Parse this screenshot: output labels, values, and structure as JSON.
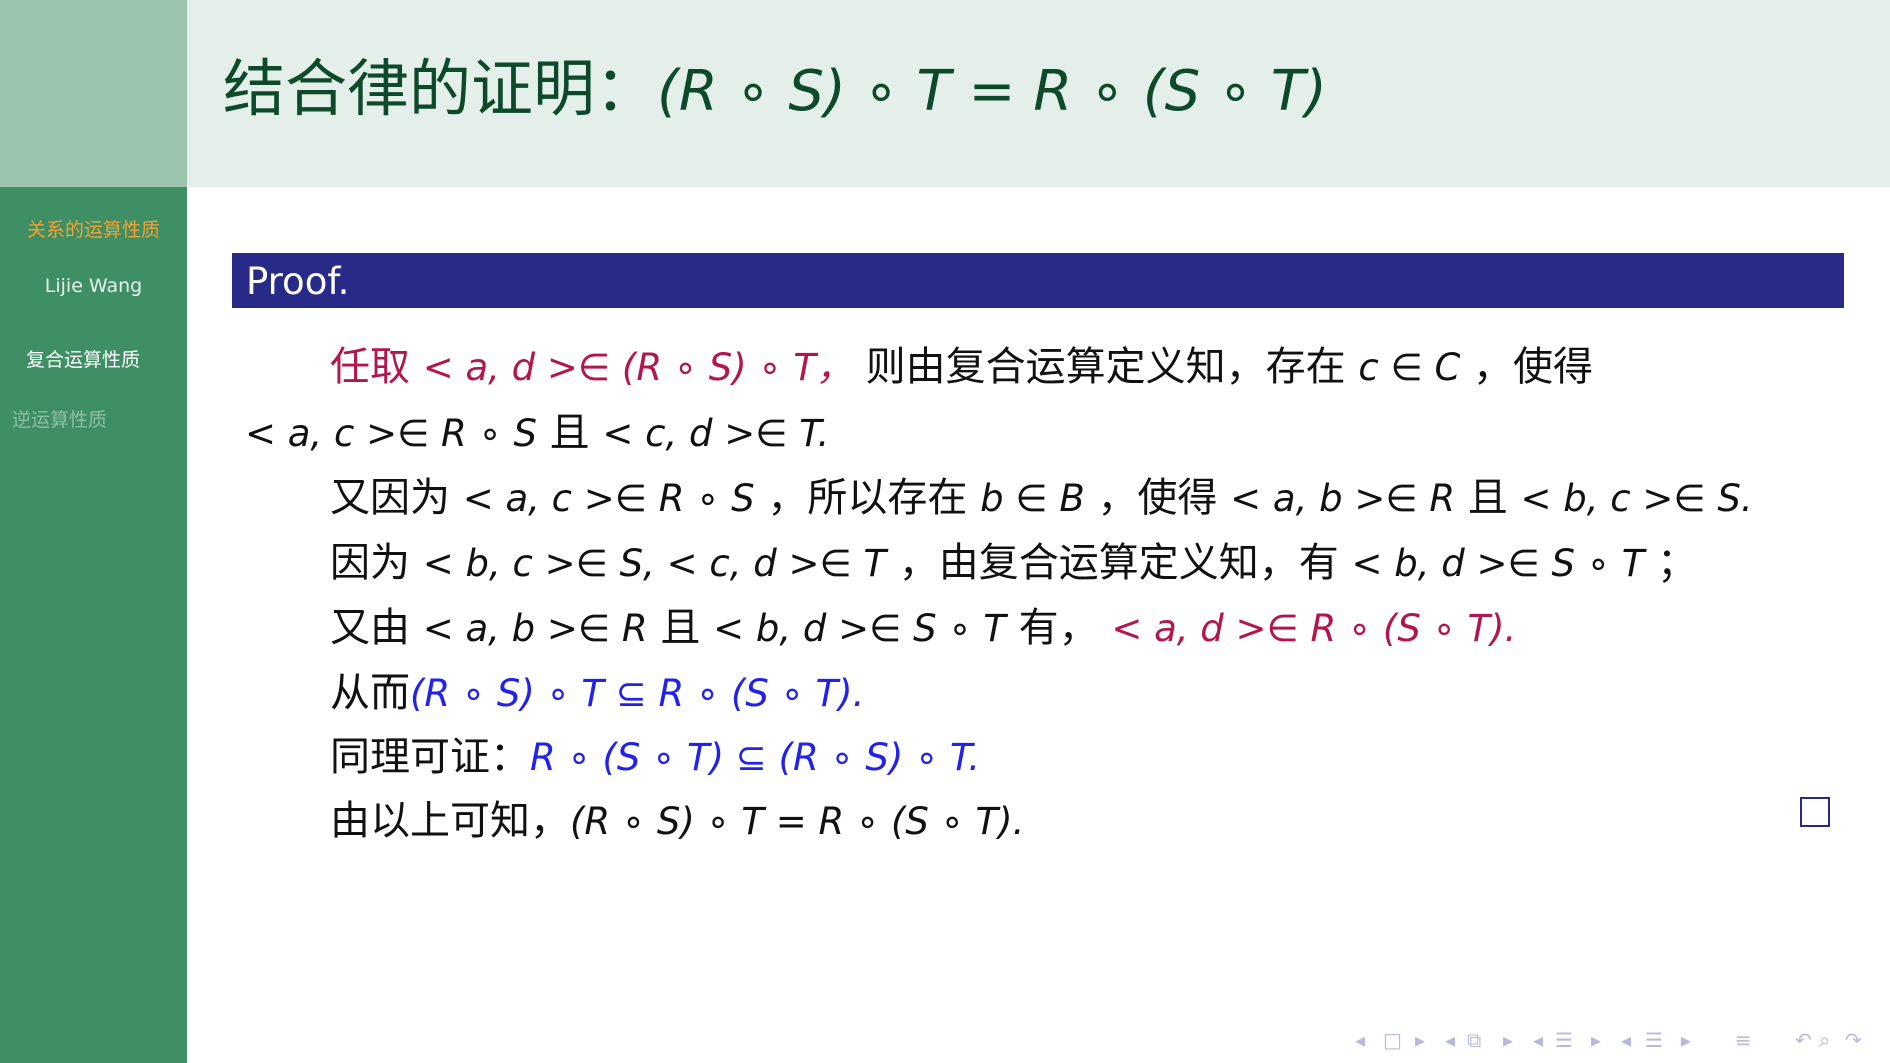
{
  "header": {
    "title_text": "结合律的证明：",
    "title_math": "(R ∘ S) ∘ T = R ∘ (S ∘ T)"
  },
  "sidebar": {
    "current_section": "关系的运算性质",
    "author": "Lijie Wang",
    "subsections": [
      {
        "label": "复合运算性质",
        "active": true
      },
      {
        "label": "逆运算性质",
        "active": false
      }
    ]
  },
  "proof": {
    "label": "Proof.",
    "lines": [
      {
        "segments": [
          "任取",
          "< a, d >∈ (R ∘ S) ∘ T，",
          "   则由复合运算定义知，存在 ",
          "c ∈ C",
          "，使得"
        ]
      },
      {
        "segments": [
          "< a, c >∈ R ∘ S",
          " 且 ",
          "< c, d >∈ T."
        ]
      },
      {
        "segments": [
          "又因为 ",
          "< a, c >∈ R ∘ S",
          "，所以存在 ",
          "b ∈ B",
          "，使得 ",
          "< a, b >∈ R",
          " 且 ",
          "< b, c >∈ S."
        ]
      },
      {
        "segments": [
          "因为 ",
          "< b, c >∈ S, < c, d >∈ T",
          "，由复合运算定义知，有 ",
          "< b, d >∈ S ∘ T",
          "；"
        ]
      },
      {
        "segments": [
          "又由 ",
          "< a, b >∈ R",
          " 且 ",
          "< b, d >∈ S ∘ T",
          " 有，  ",
          "< a, d >∈ R ∘ (S ∘ T)."
        ]
      },
      {
        "segments": [
          "从而",
          "(R ∘ S) ∘ T ⊆ R ∘ (S ∘ T)."
        ]
      },
      {
        "segments": [
          "同理可证：",
          "R ∘ (S ∘ T) ⊆ (R ∘ S) ∘ T."
        ]
      },
      {
        "segments": [
          "由以上可知，",
          "(R ∘ S) ∘ T = R ∘ (S ∘ T)."
        ]
      }
    ]
  },
  "colors": {
    "sidebar": "#3e8f63",
    "header_bg": "#e4efe9",
    "title": "#0c4a2b",
    "proof_bar": "#272a86",
    "highlight_red": "#b3164f",
    "highlight_blue": "#2222ee",
    "section_orange": "#f3a236"
  },
  "navigation_icons": [
    "nav-prev-frame-icon",
    "nav-frame-icon",
    "nav-next-frame-icon",
    "nav-prev-subsection-icon",
    "nav-subsection-icon",
    "nav-next-subsection-icon",
    "nav-prev-section-icon",
    "nav-section-icon",
    "nav-next-section-icon",
    "nav-prev-doc-icon",
    "nav-doc-icon",
    "nav-next-doc-icon",
    "nav-align-icon",
    "nav-undo-icon",
    "nav-search-icon",
    "nav-redo-icon"
  ]
}
